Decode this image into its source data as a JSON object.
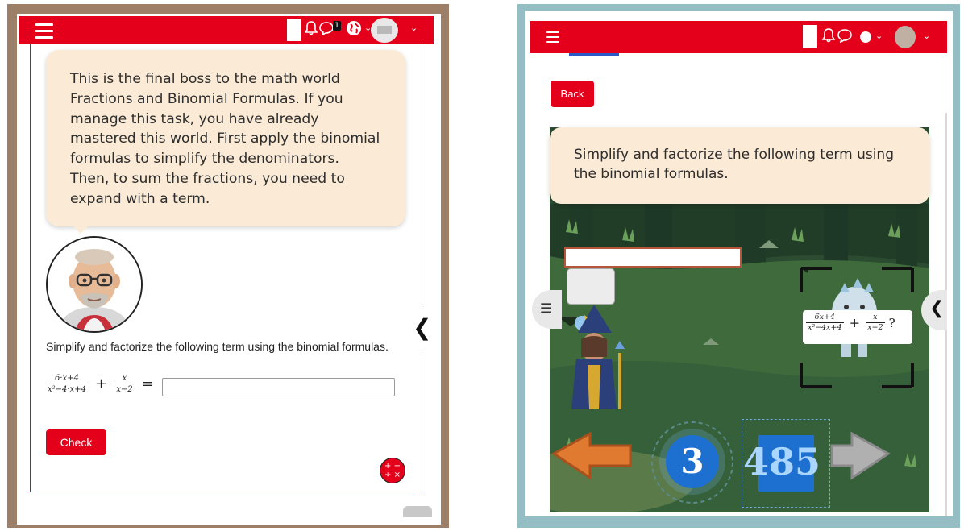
{
  "left": {
    "topbar": {
      "menu_icon": "hamburger-icon",
      "notification_icon": "bell-icon",
      "message_icon": "chat-icon",
      "message_badge": "1",
      "language_icon": "globe-icon",
      "caret": "⌄"
    },
    "intro_text": "This is the final boss to the math world Fractions and Binomial Formulas. If you manage this task, you have already mastered this world. First apply the binomial formulas to simplify the denominators. Then, to sum the fractions, you need to expand with a term.",
    "task_text": "Simplify and factorize the following term using the binomial formulas.",
    "formula": {
      "frac1_num": "6·x+4",
      "frac1_den": "x²−4·x+4",
      "plus": "+",
      "frac2_num": "x",
      "frac2_den": "x−2",
      "equals": "="
    },
    "answer_value": "",
    "check_label": "Check",
    "calculator_icon": "calculator-icon",
    "calculator_glyphs": "+ −\n÷ ×",
    "drawer_icon": "chevron-left-icon",
    "drawer_glyph": "❮"
  },
  "right": {
    "topbar": {
      "menu_icon": "hamburger-icon",
      "notification_icon": "bell-icon",
      "message_icon": "chat-icon",
      "language_icon": "globe-icon",
      "caret": "⌄"
    },
    "back_label": "Back",
    "prompt_text": "Simplify and factorize the following term using the binomial formulas.",
    "answer_value": "",
    "list_icon": "list-icon",
    "list_glyph": "☰",
    "drawer_glyph": "❮",
    "term": {
      "frac1_num": "6x+4",
      "frac1_den": "x²−4x+4",
      "plus": "+",
      "frac2_num": "x",
      "frac2_den": "x−2",
      "question": "?"
    },
    "counter": "3",
    "score": "485"
  },
  "colors": {
    "brand_red": "#e4001b",
    "bubble": "#fbebd6",
    "left_frame": "#9c7f66",
    "right_frame": "#95bdc4",
    "counter_blue": "#1d6fd0"
  }
}
